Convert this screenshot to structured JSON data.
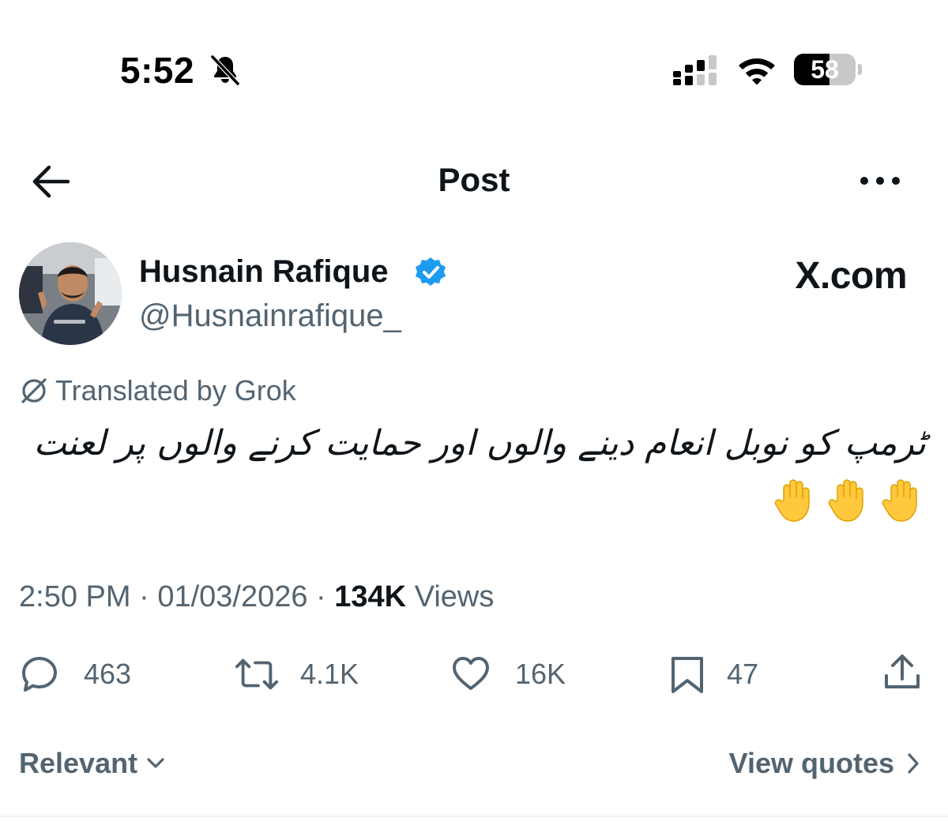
{
  "status_bar": {
    "time": "5:52",
    "battery_level": "58",
    "battery_fraction": 0.58,
    "icons": [
      "bell-slash-icon",
      "cellular-signal-icon",
      "wifi-icon",
      "battery-icon"
    ]
  },
  "header": {
    "title": "Post",
    "back_icon": "arrow-left-icon",
    "more_icon": "more-horizontal-icon"
  },
  "author": {
    "name": "Husnain Rafique",
    "handle": "@Husnainrafique_",
    "verified": true,
    "verified_color": "#1d9bf0"
  },
  "watermark": "X.com",
  "translation": {
    "label": "Translated by Grok"
  },
  "post": {
    "text": "ٹرمپ کو نوبل انعام دینے والوں اور حمایت کرنے  والوں پر لعنت",
    "emoji_count": 3,
    "emoji_icon": "raised-hand-icon"
  },
  "meta": {
    "time": "2:50 PM",
    "date": "01/03/2026",
    "views_count": "134K",
    "views_label": "Views",
    "separator": " · "
  },
  "actions": {
    "replies": "463",
    "reposts": "4.1K",
    "likes": "16K",
    "bookmarks": "47"
  },
  "footer": {
    "sort_label": "Relevant",
    "quotes_label": "View quotes"
  },
  "colors": {
    "text_primary": "#0f1419",
    "text_secondary": "#536471",
    "verified": "#1d9bf0",
    "divider": "#eff3f4"
  }
}
